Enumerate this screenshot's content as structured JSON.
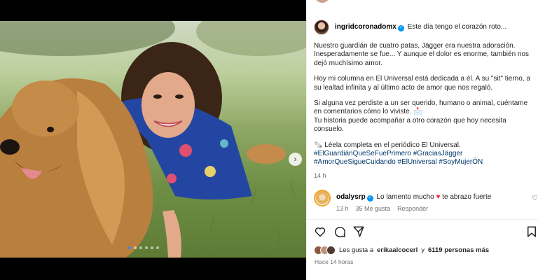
{
  "post": {
    "username": "ingridcoronadomx",
    "intro": "Este día tengo el corazón roto...",
    "p1": "Nuestro guardián de cuatro patas, Jägger era nuestra adoración. Inesperadamente se fue... Y aunque el dolor es enorme, también nos dejó muchísimo amor.",
    "p2": "Hoy mi columna en El Universal está dedicada a él. A su \"sit\" tierno, a su lealtad infinita y al último acto de amor que nos regaló.",
    "p3a": "Si alguna vez perdiste a un ser querido, humano o animal, cuéntame en comentarios cómo lo viviste. 📩",
    "p3b": "Tu historia puede acompañar a otro corazón que hoy necesita consuelo.",
    "read": "🗞️ Léela completa en el periódico El Universal.",
    "hashtags": "#ElGuardiánQueSeFuePrimero #GraciasJägger #AmorQueSigueCuidando #ElUniversal #SoyMujerÓN",
    "time": "14 h"
  },
  "comment": {
    "username": "odalysrp",
    "text": "Lo lamento mucho",
    "heart": "♥",
    "text2": "te abrazo fuerte",
    "time": "13 h",
    "likes": "35 Me gusta",
    "reply": "Responder"
  },
  "likes": {
    "prefix": "Les gusta a",
    "user": "erikaalcocerl",
    "middle": "y",
    "count": "6119 personas más"
  },
  "ago": "Hace 14 horas",
  "icons": [
    "heart-icon",
    "comment-icon",
    "share-icon",
    "save-icon",
    "verified-icon",
    "next-icon"
  ],
  "colors": {
    "accent": "#0095f6",
    "link": "#00376b",
    "secondary": "#737373",
    "heart": "#ed2f43"
  }
}
